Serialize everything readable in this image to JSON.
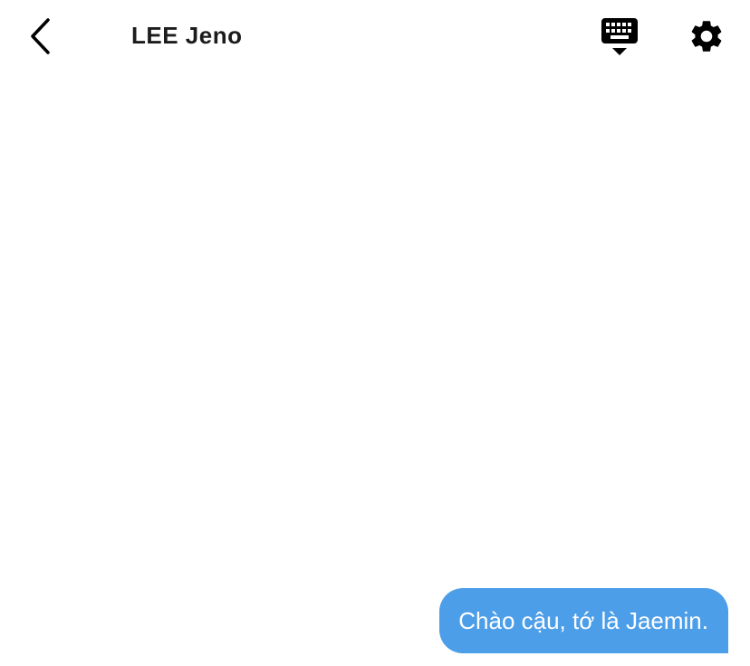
{
  "header": {
    "title": "LEE Jeno",
    "back_icon": "chevron-left-icon",
    "keyboard_icon": "keyboard-hide-icon",
    "settings_icon": "gear-icon"
  },
  "messages": [
    {
      "direction": "outgoing",
      "text": "Chào cậu, tớ là Jaemin.",
      "bubble_color": "#4d9ee8"
    }
  ]
}
